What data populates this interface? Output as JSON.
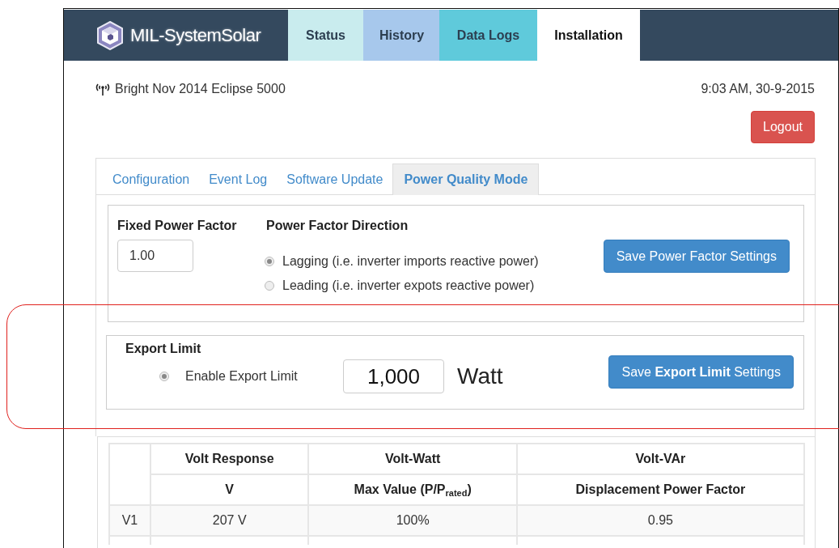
{
  "app": {
    "name": "MIL-SystemSolar"
  },
  "nav_tabs": [
    {
      "label": "Status",
      "selected": false,
      "color": "#c9ecee"
    },
    {
      "label": "History",
      "selected": false,
      "color": "#a7c8ec"
    },
    {
      "label": "Data Logs",
      "selected": false,
      "color": "#5fcadb"
    },
    {
      "label": "Installation",
      "selected": true,
      "color": "#ffffff"
    }
  ],
  "device": {
    "name": "Bright Nov 2014 Eclipse 5000",
    "datetime": "9:03 AM, 30-9-2015"
  },
  "logout_button": "Logout",
  "settings_tabs": [
    {
      "label": "Configuration",
      "selected": false
    },
    {
      "label": "Event Log",
      "selected": false
    },
    {
      "label": "Software Update",
      "selected": false
    },
    {
      "label": "Power Quality Mode",
      "selected": true
    }
  ],
  "power_factor": {
    "fixed_label": "Fixed Power Factor",
    "fixed_value": "1.00",
    "direction_label": "Power Factor Direction",
    "options": [
      {
        "label": "Lagging (i.e. inverter imports reactive power)",
        "selected": true
      },
      {
        "label": "Leading (i.e. inverter expots reactive power)",
        "selected": false
      }
    ],
    "save_button": "Save Power Factor Settings"
  },
  "export_limit": {
    "title": "Export Limit",
    "enable_label": "Enable Export Limit",
    "enabled": true,
    "value": "1,000",
    "unit": "Watt",
    "save_button": "Save **Export Limit** Settings"
  },
  "table": {
    "group_headers": [
      "Volt Response",
      "Volt-Watt",
      "Volt-VAr"
    ],
    "sub_headers": [
      "V",
      "Max Value (P/P$_{rated}$)",
      "Displacement Power Factor"
    ],
    "rows": [
      [
        "V1",
        "207 V",
        "100%",
        "0.95"
      ]
    ]
  }
}
